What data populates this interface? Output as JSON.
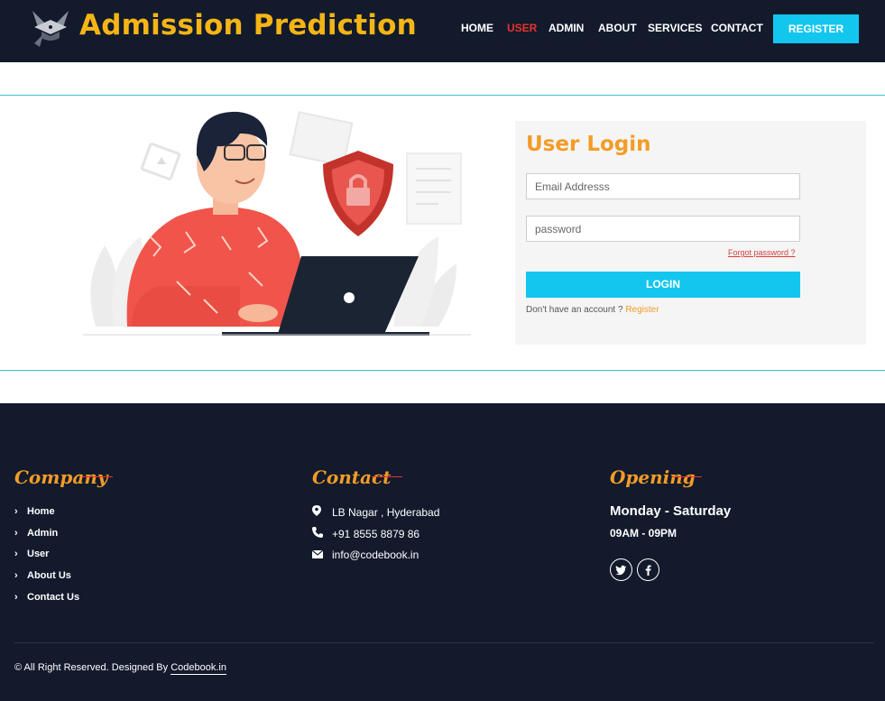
{
  "header": {
    "brand": "Admission Prediction",
    "nav": [
      "HOME",
      "USER",
      "ADMIN",
      "ABOUT",
      "SERVICES",
      "CONTACT"
    ],
    "active_nav": "USER",
    "register_button": "REGISTER"
  },
  "login": {
    "title": "User Login",
    "email_placeholder": "Email Addresss",
    "password_placeholder": "password",
    "forgot": "Forgot password ?",
    "login_button": "LOGIN",
    "no_account": "Don't have an account ?",
    "register_link": "Register"
  },
  "footer": {
    "company": {
      "heading": "Company",
      "links": [
        "Home",
        "Admin",
        "User",
        "About Us",
        "Contact Us"
      ]
    },
    "contact": {
      "heading": "Contact",
      "address": "LB Nagar , Hyderabad",
      "phone": "+91 8555 8879 86",
      "email": "info@codebook.in"
    },
    "opening": {
      "heading": "Opening",
      "days": "Monday - Saturday",
      "hours": "09AM - 09PM"
    },
    "copyright_prefix": "© All Right Reserved. Designed By",
    "copyright_link": "Codebook.in"
  },
  "colors": {
    "navy": "#121a2c",
    "accent_orange": "#f39c27",
    "brand_yellow": "#f5b514",
    "cyan": "#12c6ee",
    "active_red": "#e8332f"
  },
  "icons": {
    "logo": "graduation-cap-icon",
    "chevron": "chevron-right-icon",
    "address": "map-marker-icon",
    "phone": "phone-icon",
    "email": "envelope-icon",
    "twitter": "twitter-icon",
    "facebook": "facebook-icon"
  }
}
